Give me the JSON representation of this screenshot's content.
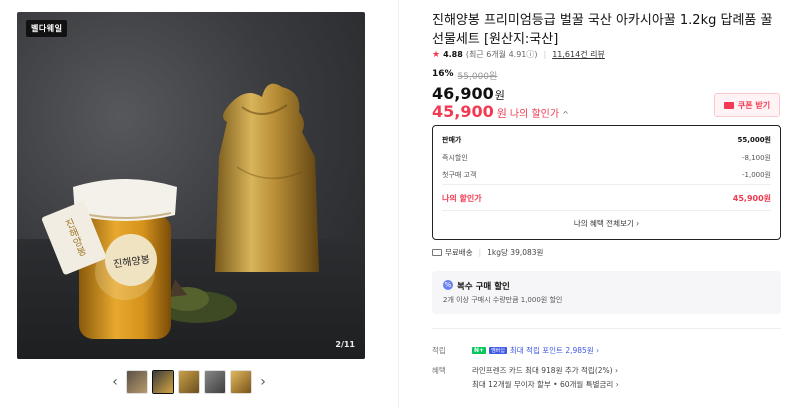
{
  "gallery": {
    "brand_badge": "벨다웨일",
    "counter": "2/11",
    "jar_label": "진해양봉",
    "tag_label": "진해양봉",
    "prev_label": "‹",
    "next_label": "›",
    "thumb_count": 5,
    "active_thumb": 2
  },
  "product": {
    "title": "진해양봉 프리미엄등급 벌꿀 국산 아카시아꿀 1.2kg 답례품 꿀 선물세트 [원산지:국산]",
    "rating": "4.88",
    "rating_recent": "(최근 6개월 4.91ⓘ)",
    "reviews": "11,614건 리뷰",
    "discount_rate": "16%",
    "original_price": "55,000원",
    "price": "46,900",
    "price_unit": "원",
    "my_price": "45,900",
    "my_price_unit": "원",
    "my_price_label": "나의 할인가",
    "my_price_chevron": "^",
    "coupon_label": "쿠폰 받기"
  },
  "breakdown": {
    "rows": [
      {
        "label": "판매가",
        "value": "55,000원"
      },
      {
        "label": "즉시할인",
        "value": "-8,100원"
      },
      {
        "label": "첫구매 고객",
        "value": "-1,000원"
      }
    ],
    "total_label": "나의 할인가",
    "total_value": "45,900원",
    "more_label": "나의 혜택 전체보기 ›"
  },
  "shipping": {
    "text": "무료배송",
    "unit_price": "1kg당 39,083원"
  },
  "multi_buy": {
    "icon": "%",
    "title": "복수 구매 할인",
    "desc": "2개 이상 구매시 수량만큼 1,000원 할인"
  },
  "points": {
    "label": "적립",
    "npay": "N+",
    "badge": "멤버십",
    "text": "최대 적립 포인트 2,985원 ›"
  },
  "benefits": {
    "label": "혜택",
    "line1": "라인프렌즈 카드 최대 918원 추가 적립(2%) ›",
    "line2": "최대 12개월 무이자 할부 • 60개월 특별금리 ›"
  },
  "colors": {
    "accent_red": "#f23a52",
    "link_blue": "#3f58e6",
    "gold": "#c49a3a"
  }
}
